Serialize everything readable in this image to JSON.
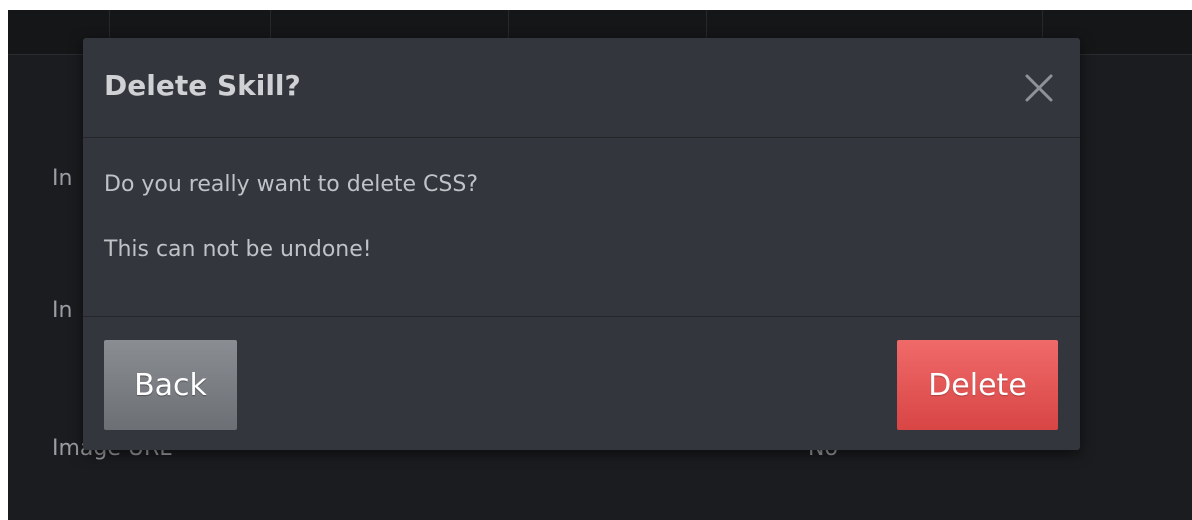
{
  "background": {
    "row_labels": [
      "In",
      "In",
      "Image URL"
    ],
    "right_value": "No"
  },
  "modal": {
    "title": "Delete Skill?",
    "close_icon": "close-icon",
    "message": "Do you really want to delete CSS?",
    "warning": "This can not be undone!",
    "back_label": "Back",
    "delete_label": "Delete"
  },
  "colors": {
    "modal_bg": "#33363c",
    "page_bg": "#1b1c1f",
    "back_button": "#7b7f84",
    "delete_button": "#e55757"
  }
}
